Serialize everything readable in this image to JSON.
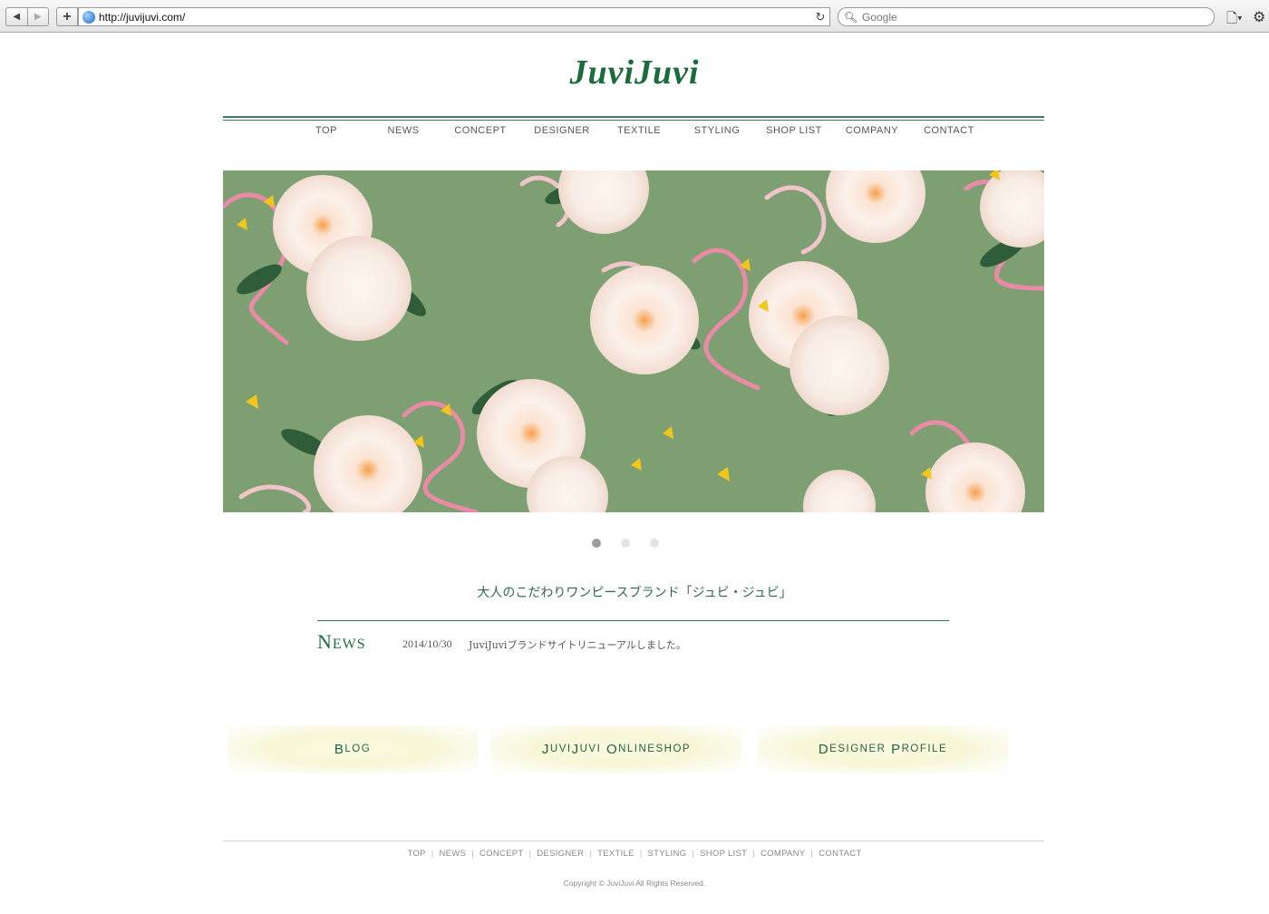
{
  "browser": {
    "url": "http://juvijuvi.com/",
    "search_placeholder": "Google",
    "back_icon": "back-arrow-icon",
    "forward_icon": "forward-arrow-icon"
  },
  "site": {
    "logo": "JuviJuvi",
    "nav": [
      "TOP",
      "NEWS",
      "CONCEPT",
      "DESIGNER",
      "TEXTILE",
      "STYLING",
      "SHOP LIST",
      "COMPANY",
      "CONTACT"
    ],
    "tagline": "大人のこだわりワンピースブランド「ジュビ・ジュビ」",
    "news": {
      "title_first": "N",
      "title_rest": "EWS",
      "date": "2014/10/30",
      "text": "JuviJuviブランドサイトリニューアルしました。"
    },
    "banners": [
      {
        "first": "B",
        "rest": "LOG"
      },
      {
        "first": "J",
        "rest": "UVI",
        "first2": "J",
        "rest2": "UVI",
        "first3": "O",
        "rest3": "NLINESHOP"
      },
      {
        "first": "D",
        "rest": "ESIGNER",
        "first2": "P",
        "rest2": "ROFILE"
      }
    ],
    "footer_nav": [
      "TOP",
      "NEWS",
      "CONCEPT",
      "DESIGNER",
      "TEXTILE",
      "STYLING",
      "SHOP LIST",
      "COMPANY",
      "CONTACT"
    ],
    "copyright": "Copyright © JuviJuvi All Rights Reserved."
  },
  "slider": {
    "slides": 3,
    "active": 0
  },
  "colors": {
    "brand_green": "#1b6b3b",
    "hero_bg": "#7d9f72"
  }
}
